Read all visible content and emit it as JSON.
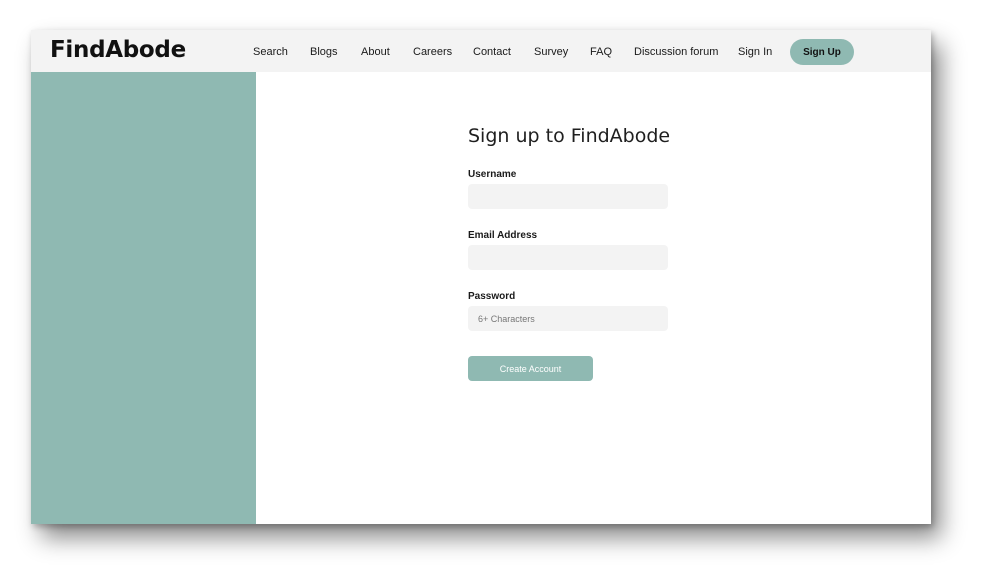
{
  "brand": {
    "name": "FindAbode"
  },
  "nav": {
    "links": [
      "Search",
      "Blogs",
      "About",
      "Careers",
      "Contact",
      "Survey",
      "FAQ",
      "Discussion forum",
      "Sign In"
    ],
    "signup_label": "Sign Up"
  },
  "form": {
    "title": "Sign up to FindAbode",
    "username_label": "Username",
    "username_value": "",
    "username_placeholder": "",
    "email_label": "Email Address",
    "email_value": "",
    "email_placeholder": "",
    "password_label": "Password",
    "password_value": "",
    "password_placeholder": "6+ Characters",
    "submit_label": "Create Account"
  },
  "colors": {
    "accent": "#8fb9b2",
    "navbar_bg": "#f3f3f3",
    "input_bg": "#f3f3f3"
  }
}
